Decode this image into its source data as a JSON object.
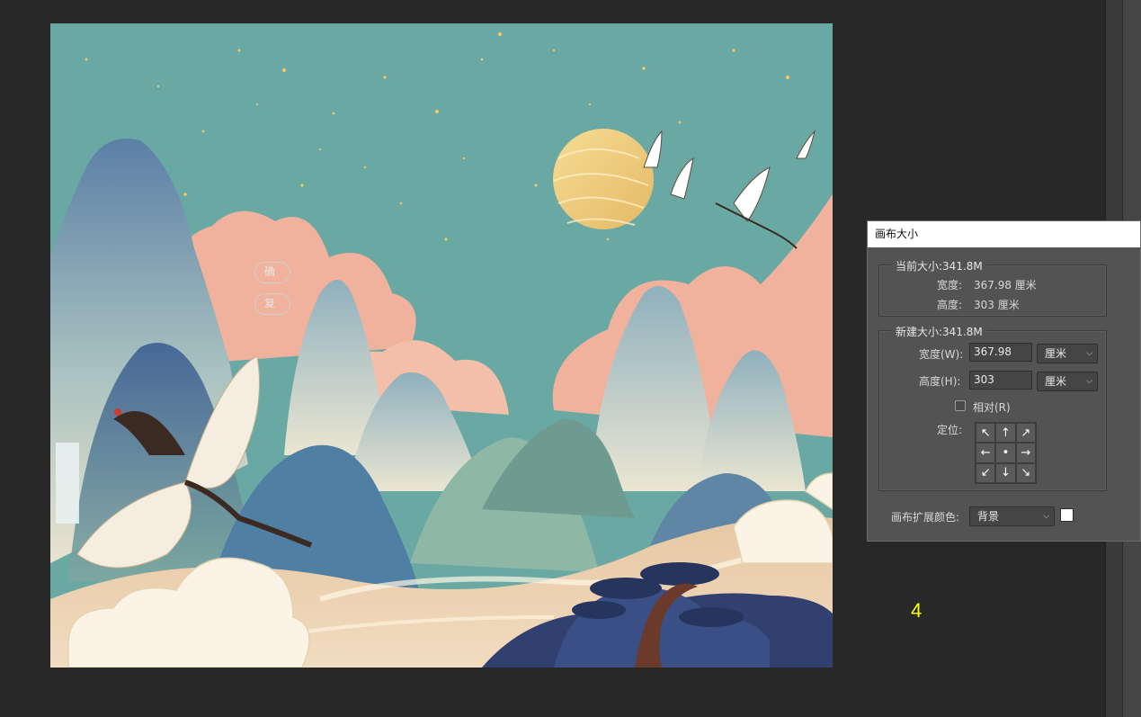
{
  "dialog": {
    "title": "画布大小",
    "current": {
      "legend": "当前大小:341.8M",
      "width_label": "宽度:",
      "width_value": "367.98 厘米",
      "height_label": "高度:",
      "height_value": "303 厘米"
    },
    "new": {
      "legend": "新建大小:341.8M",
      "width_label": "宽度(W):",
      "width_value": "367.98",
      "width_unit": "厘米",
      "height_label": "高度(H):",
      "height_value": "303",
      "height_unit": "厘米",
      "relative_label": "相对(R)",
      "relative_checked": false,
      "anchor_label": "定位:",
      "anchor_arrows": [
        "↖",
        "↑",
        "↗",
        "←",
        "•",
        "→",
        "↙",
        "↓",
        "↘"
      ]
    },
    "extension_color_label": "画布扩展颜色:",
    "extension_color_value": "背景",
    "extension_color_swatch": "#ffffff",
    "ok_button": "确",
    "reset_button": "复"
  },
  "annotation": "4",
  "colors": {
    "workspace": "#282828",
    "dialog_bg": "#535353",
    "annotation": "#ffff00",
    "sky": "#6aa9a3",
    "moon": "#f0cf7f",
    "cloud_pink": "#f0b29c"
  }
}
